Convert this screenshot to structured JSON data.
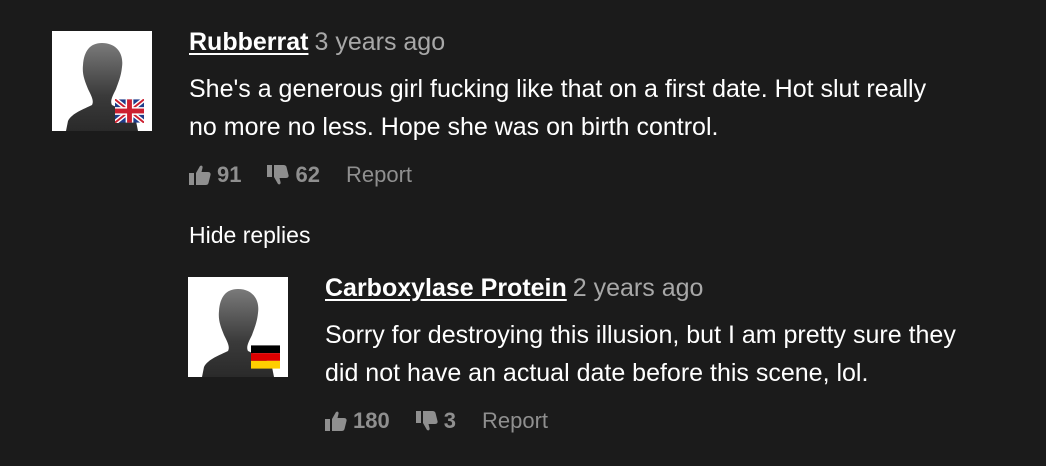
{
  "comments": [
    {
      "username": "Rubberrat",
      "timestamp": "3 years ago",
      "text_lines": [
        "She's a generous girl fucking like that on a first date. Hot slut really",
        "no more no less. Hope she was on birth control."
      ],
      "likes": "91",
      "dislikes": "62",
      "report_label": "Report",
      "flag": "uk-flag-icon"
    }
  ],
  "hide_replies_label": "Hide replies",
  "replies": [
    {
      "username": "Carboxylase Protein",
      "timestamp": "2 years ago",
      "text_lines": [
        "Sorry for destroying this illusion, but I am pretty sure they",
        "did not have an actual date before this scene, lol."
      ],
      "likes": "180",
      "dislikes": "3",
      "report_label": "Report",
      "flag": "germany-flag-icon"
    }
  ],
  "colors": {
    "background": "#1b1b1b",
    "text": "#ffffff",
    "muted": "#a8a8a8",
    "actions": "#8f8f8f"
  }
}
